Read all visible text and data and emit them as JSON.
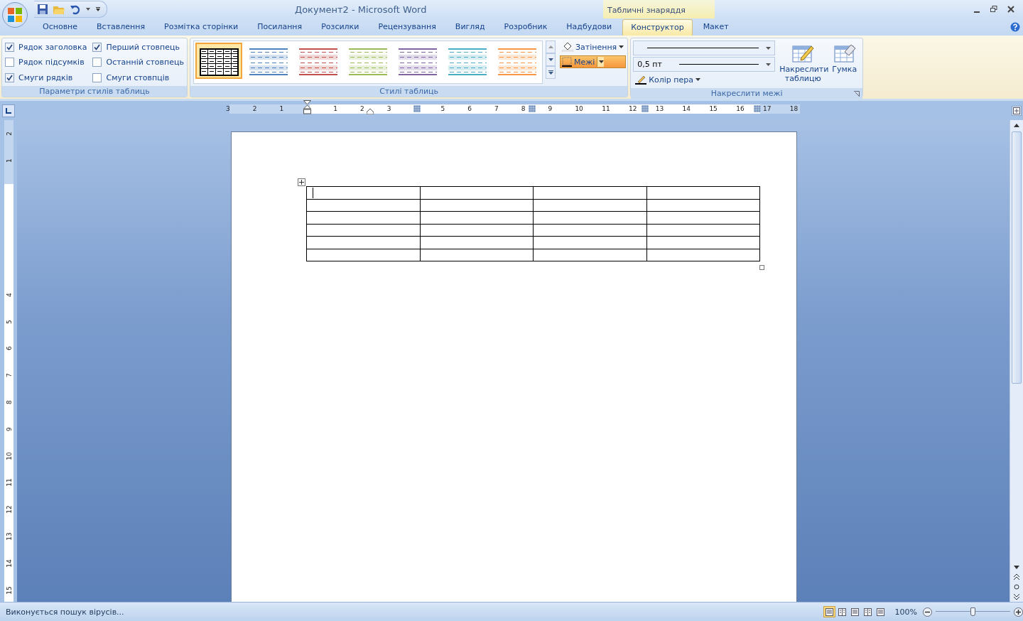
{
  "title_bar": {
    "title": "Документ2 - Microsoft Word",
    "contextual_group": "Табличні знаряддя"
  },
  "tabs": [
    {
      "label": "Основне",
      "selected": false
    },
    {
      "label": "Вставлення",
      "selected": false
    },
    {
      "label": "Розмітка сторінки",
      "selected": false
    },
    {
      "label": "Посилання",
      "selected": false
    },
    {
      "label": "Розсилки",
      "selected": false
    },
    {
      "label": "Рецензування",
      "selected": false
    },
    {
      "label": "Вигляд",
      "selected": false
    },
    {
      "label": "Розробник",
      "selected": false
    },
    {
      "label": "Надбудови",
      "selected": false
    },
    {
      "label": "Конструктор",
      "selected": true
    },
    {
      "label": "Макет",
      "selected": false
    }
  ],
  "style_options": {
    "label": "Параметри стилів таблиць",
    "items": [
      {
        "label": "Рядок заголовка",
        "checked": true
      },
      {
        "label": "Рядок підсумків",
        "checked": false
      },
      {
        "label": "Смуги рядків",
        "checked": true
      },
      {
        "label": "Перший стовпець",
        "checked": true
      },
      {
        "label": "Останній стовпець",
        "checked": false
      },
      {
        "label": "Смуги стовпців",
        "checked": false
      }
    ]
  },
  "table_styles": {
    "label": "Стилі таблиць",
    "styles": [
      {
        "color": "#000000",
        "selected": true
      },
      {
        "color": "#4f81bd",
        "selected": false
      },
      {
        "color": "#c0504d",
        "selected": false
      },
      {
        "color": "#9bbb59",
        "selected": false
      },
      {
        "color": "#8064a2",
        "selected": false
      },
      {
        "color": "#4bacc6",
        "selected": false
      },
      {
        "color": "#f79646",
        "selected": false
      }
    ],
    "shading": "Затінення",
    "borders": "Межі"
  },
  "draw_borders": {
    "label": "Накреслити межі",
    "line_weight": "0,5 пт",
    "pen_color": "Колір пера",
    "draw_table": "Накреслити таблицю",
    "eraser": "Гумка"
  },
  "ruler": {
    "numbers": [
      "3",
      "2",
      "1",
      "1",
      "2",
      "3",
      "5",
      "6",
      "7",
      "8",
      "9",
      "10",
      "11",
      "12",
      "13",
      "14",
      "15",
      "16",
      "17",
      "18"
    ],
    "vertical_numbers": [
      "2",
      "1",
      "4",
      "5",
      "6",
      "7",
      "8",
      "9",
      "10",
      "11",
      "12",
      "13",
      "14",
      "15"
    ]
  },
  "status_bar": {
    "message": "Виконується пошук вірусів...",
    "zoom": "100%",
    "zoom_slider": {
      "level": 0.5
    }
  }
}
